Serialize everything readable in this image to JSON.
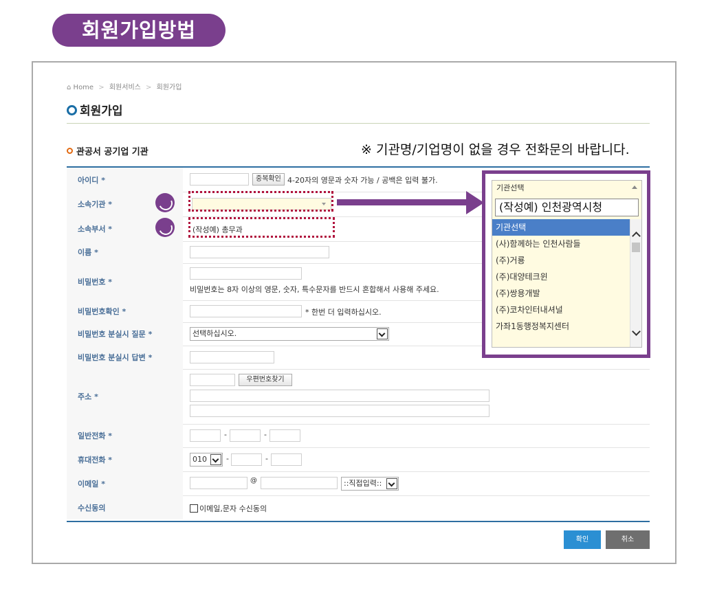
{
  "banner": {
    "title": "회원가입방법"
  },
  "breadcrumb": {
    "home": "Home",
    "service": "회원서비스",
    "current": "회원가입"
  },
  "page_title": "회원가입",
  "section_label": "관공서 공기업 기관",
  "notice": "※ 기관명/기업명이 없을 경우 전화문의 바랍니다.",
  "fields": {
    "id": {
      "label": "아이디 *",
      "check_button": "중복확인",
      "hint": "4-20자의 영문과 숫자 가능 / 공백은 입력 불가."
    },
    "org": {
      "label": "소속기관 *"
    },
    "dept": {
      "label": "소속부서 *",
      "value": "(작성예) 총무과"
    },
    "name": {
      "label": "이름 *"
    },
    "password": {
      "label": "비밀번호 *",
      "hint": "비밀번호는 8자 이상의 영문, 숫자, 특수문자를 반드시 혼합해서 사용해 주세요."
    },
    "password_confirm": {
      "label": "비밀번호확인 *",
      "hint": "* 한번 더 입력하십시오."
    },
    "pw_question": {
      "label": "비밀번호 분실시 질문 *",
      "selected": "선택하십시오."
    },
    "pw_answer": {
      "label": "비밀번호 분실시 답변 *"
    },
    "address": {
      "label": "주소 *",
      "zip_button": "우편번호찾기"
    },
    "phone": {
      "label": "일반전화 *",
      "dash": "-"
    },
    "mobile": {
      "label": "휴대전화 *",
      "prefix": "010",
      "dash": "-"
    },
    "email": {
      "label": "이메일 *",
      "at": "@",
      "domain_select": "::직접입력::"
    },
    "consent": {
      "label": "수신동의",
      "checkbox_label": "이메일,문자 수신동의"
    }
  },
  "dropdown": {
    "header": "기관선택",
    "search_value": "(작성예) 인천광역시청",
    "items": [
      "기관선택",
      "(사)함께하는 인천사람들",
      "(주)거룡",
      "(주)대양테크윈",
      "(주)쌍용개발",
      "(주)코차인터내셔널",
      "가좌1동행정복지센터"
    ]
  },
  "buttons": {
    "ok": "확인",
    "cancel": "취소"
  },
  "colors": {
    "accent_purple": "#7a3f8d",
    "link_blue": "#4a6f98",
    "highlight_red": "#b0113c",
    "ok_blue": "#2b8fd3"
  }
}
